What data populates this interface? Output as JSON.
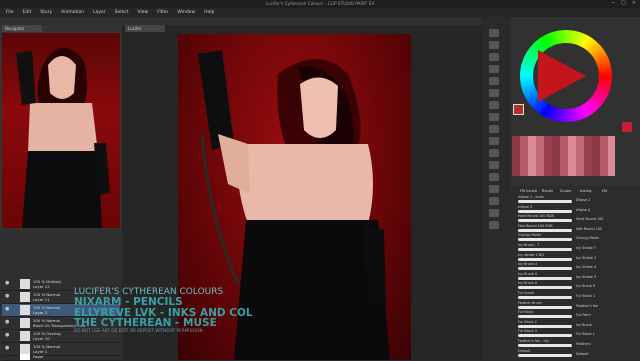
{
  "window": {
    "title": "Lucifer's Cytherean Colours - CLIP STUDIO PAINT EX",
    "controls": [
      "−",
      "□",
      "×"
    ]
  },
  "menu": [
    "File",
    "Edit",
    "Story",
    "Animation",
    "Layer",
    "Select",
    "View",
    "Filter",
    "Window",
    "Help"
  ],
  "navigator": {
    "tab_label": "Navigator"
  },
  "canvas": {
    "tab_label": "Lucifer"
  },
  "layers": [
    {
      "label": "100 % Multiply",
      "sub": "Layer 12"
    },
    {
      "label": "100 % Normal",
      "sub": "Layer 11"
    },
    {
      "label": "100 % Normal",
      "sub": "Layer 2"
    },
    {
      "label": "100 % Normal",
      "sub": "Block On Transparency Corr"
    },
    {
      "label": "100 % Overlay",
      "sub": "Layer 10"
    },
    {
      "label": "100 % Normal",
      "sub": "Layer 1"
    },
    {
      "label": "",
      "sub": "Paper"
    }
  ],
  "brushes": {
    "tabs": [
      "Fill brush",
      "Brush",
      "G-pen",
      "Inking",
      "Fill"
    ],
    "items": [
      {
        "left": "ellipse 1 - bush",
        "right": "Ellipse 2"
      },
      {
        "left": "ellipse 3",
        "right": "ellipse 4"
      },
      {
        "left": "Hard Round 100 RGB",
        "right": "Hard Round 100"
      },
      {
        "left": "Fine Round 100 RGB",
        "right": "Soft Round 100"
      },
      {
        "left": "Grungy Roller",
        "right": "Grungy Roller"
      },
      {
        "left": "Ivy Brush - T",
        "right": "Ivy Stroke T"
      },
      {
        "left": "Ivy stroke 2 NO",
        "right": "Ivy Stroke 2"
      },
      {
        "left": "Ivy Brush 4",
        "right": "Ivy Stroke 4"
      },
      {
        "left": "Ivy Brush 5",
        "right": "Ivy Stroke 5"
      },
      {
        "left": "Ivy Brush 6",
        "right": "Ivy Brush 6"
      },
      {
        "left": "Fur brush",
        "right": "Fur Brush 1"
      },
      {
        "left": "Feather Brush",
        "right": "Feather's fan"
      },
      {
        "left": "Fur Block",
        "right": "Fur Paint"
      },
      {
        "left": "Fur Block 2",
        "right": "Ivy Brush"
      },
      {
        "left": "Fur Block 3",
        "right": "Fur Block 1"
      },
      {
        "left": "Feather's fan - dry",
        "right": "Feathers"
      },
      {
        "left": "Default",
        "right": "Default"
      }
    ]
  },
  "credits": {
    "title": "LUCIFER'S CYTHEREAN COLOURS",
    "line1": "NIXARM - PENCILS",
    "line2": "ELLYREVE LVK - INKS AND COL",
    "line3": "THE CYTHEREAN - MUSE",
    "note": "DO NOT USE ART OR EDIT OR REPOST WITHOUT PERMISSION"
  },
  "colors": {
    "main": "#b03030",
    "sub": "#c02030",
    "accent": "#3aa0a8"
  }
}
